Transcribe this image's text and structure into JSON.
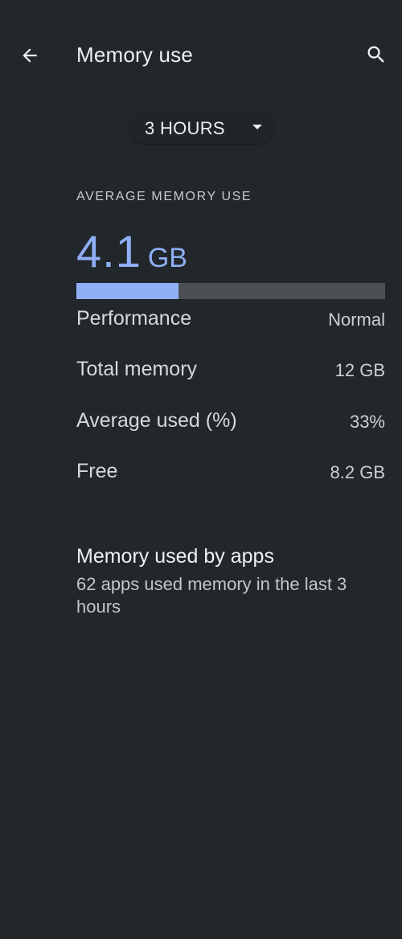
{
  "header": {
    "title": "Memory use",
    "back_icon": "arrow-back-icon",
    "search_icon": "search-icon"
  },
  "period_selector": {
    "selected": "3 HOURS",
    "arrow_icon": "dropdown-arrow-icon"
  },
  "summary": {
    "section_label": "AVERAGE MEMORY USE",
    "average_value": "4.1",
    "average_unit": "GB",
    "usage_fraction": 0.33,
    "accent_color": "#8fb0f6"
  },
  "stats": [
    {
      "label": "Performance",
      "value": "Normal"
    },
    {
      "label": "Total memory",
      "value": "12 GB"
    },
    {
      "label": "Average used (%)",
      "value": "33%"
    },
    {
      "label": "Free",
      "value": "8.2 GB"
    }
  ],
  "apps_section": {
    "title": "Memory used by apps",
    "subtitle": "62 apps used memory in the last 3 hours"
  }
}
